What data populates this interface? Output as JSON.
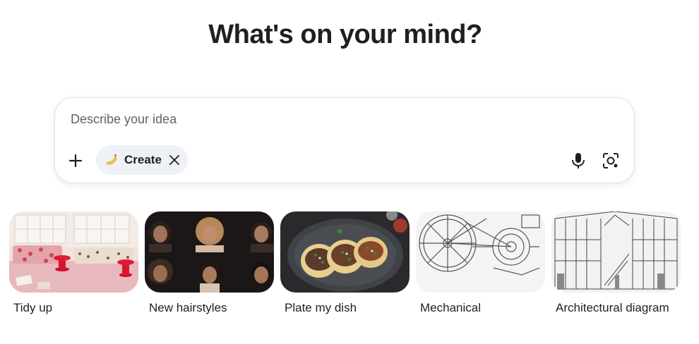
{
  "header": {
    "title": "What's on your mind?"
  },
  "prompt": {
    "placeholder": "Describe your idea",
    "value": "",
    "add_icon": "plus-icon",
    "mode_chip": {
      "label": "Create",
      "icon": "banana-icon",
      "close_icon": "close-icon"
    },
    "mic_icon": "microphone-icon",
    "camera_icon": "camera-icon"
  },
  "suggestions": [
    {
      "label": "Tidy up",
      "image": "messy-living-room"
    },
    {
      "label": "New hairstyles",
      "image": "hairstyle-portraits-grid"
    },
    {
      "label": "Plate my dish",
      "image": "tacos-on-plate"
    },
    {
      "label": "Mechanical",
      "image": "bicycle-drivetrain-sketch"
    },
    {
      "label": "Architectural diagram",
      "image": "building-section-drawing"
    }
  ],
  "colors": {
    "chip_bg": "#eef1f5",
    "border": "#dcdfe3",
    "text": "#1f1f1f",
    "placeholder": "#5f6368"
  }
}
